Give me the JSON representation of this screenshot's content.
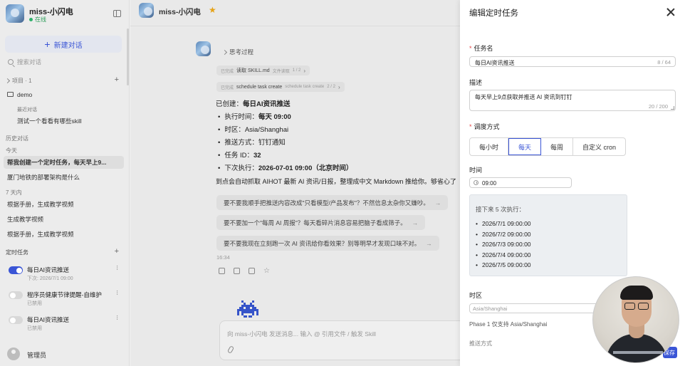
{
  "sidebar": {
    "app_name": "miss-小闪电",
    "status": "在线",
    "new_chat": "新建对话",
    "search_placeholder": "搜索对话",
    "projects_header": "项目 · 1",
    "project_name": "demo",
    "recent_label": "最近对话",
    "project_chat": "测试一个看看有哪些skill",
    "history_header": "历史对话",
    "today_label": "今天",
    "today_items": [
      "帮我创建一个定时任务，每天早上9...",
      "厦门地铁的部署架构是什么"
    ],
    "week_label": "7 天内",
    "week_items": [
      "根据手册，生成教学视频",
      "生成教学视频",
      "根据手册，生成教学视频"
    ],
    "tasks_header": "定时任务",
    "tasks": [
      {
        "title": "每日AI资讯推送",
        "sub": "下次: 2026/7/1 09:00",
        "enabled": true
      },
      {
        "title": "程序员健康节律提醒-自维护",
        "sub": "已禁用",
        "enabled": false
      },
      {
        "title": "每日AI资讯推送",
        "sub": "已禁用",
        "enabled": false
      }
    ],
    "user": "管理员"
  },
  "chat": {
    "title": "miss-小闪电",
    "think_label": "思考过程",
    "tool_calls": [
      {
        "kind": "已完成",
        "name": "读取 SKILL.md",
        "type": "文件读取",
        "step": "1 / 2"
      },
      {
        "kind": "已完成",
        "name": "schedule task create",
        "type": "schedule task create",
        "step": "2 / 2"
      }
    ],
    "created_prefix": "已创建：",
    "created_name": "每日AI资讯推送",
    "details": [
      {
        "label": "执行时间：",
        "value": "每天 09:00",
        "bold": true
      },
      {
        "label": "时区：",
        "value": "Asia/Shanghai",
        "bold": false
      },
      {
        "label": "推送方式：",
        "value": "钉钉通知",
        "bold": false
      },
      {
        "label": "任务 ID：",
        "value": "32",
        "bold": true
      },
      {
        "label": "下次执行：",
        "value": "2026-07-01 09:00（北京时间）",
        "bold": true
      }
    ],
    "summary": "到点会自动抓取 AIHOT 最新 AI 资讯/日报，整理成中文 Markdown 推给你。够省心了",
    "suggestions": [
      "要不要我顺手把推送内容改成\"只看模型/产品发布\"？不然信息太杂你又嫌吵。",
      "要不要加一个\"每周 AI 周报\"？每天看碎片消息容易把脑子看成筛子。",
      "要不要我现在立刻跑一次 AI 资讯给你看效果？别等明早才发现口味不对。"
    ],
    "time": "16:34",
    "composer_placeholder": "向 miss-小闪电 发送消息... 输入 @ 引用文件 / 触发 Skill"
  },
  "panel": {
    "title": "编辑定时任务",
    "name_label": "任务名",
    "name_value": "每日AI资讯推送",
    "name_count": "8 / 64",
    "desc_label": "描述",
    "desc_value": "每天早上9点获取并推送 AI 资讯到钉钉",
    "desc_count": "20 / 200",
    "schedule_label": "调度方式",
    "schedule_options": [
      "每小时",
      "每天",
      "每周",
      "自定义 cron"
    ],
    "schedule_selected": "每天",
    "time_label": "时间",
    "time_value": "09:00",
    "preview_title": "接下来 5 次执行：",
    "preview_runs": [
      "2026/7/1 09:00:00",
      "2026/7/2 09:00:00",
      "2026/7/3 09:00:00",
      "2026/7/4 09:00:00",
      "2026/7/5 09:00:00"
    ],
    "tz_label": "时区",
    "tz_value": "Asia/Shanghai",
    "tz_help": "Phase 1 仅支持 Asia/Shanghai",
    "partial_label": "推送方式",
    "save_label": "保存"
  },
  "colors": {
    "accent": "#3a55d6",
    "required": "#e54545",
    "online": "#2eb16a",
    "star": "#e6a317"
  }
}
